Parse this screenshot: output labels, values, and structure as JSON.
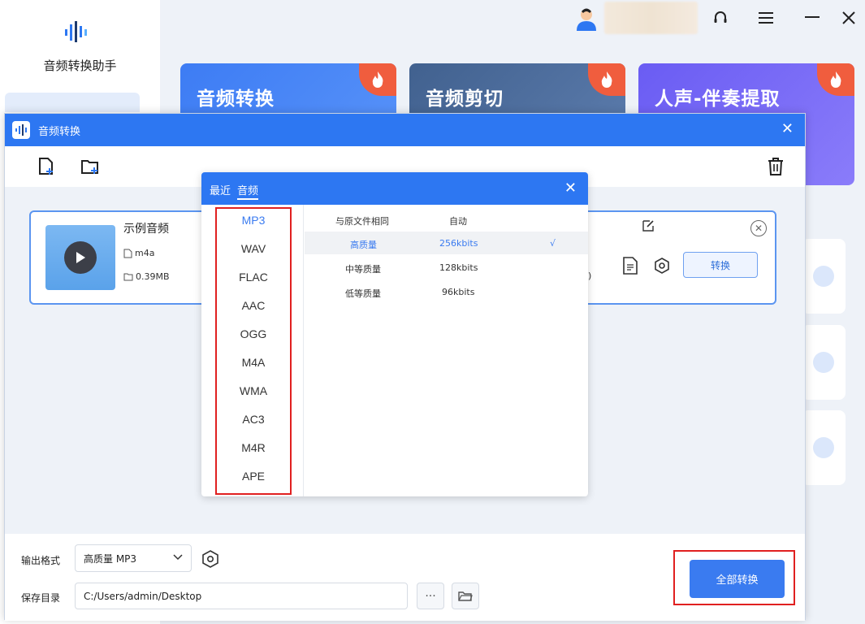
{
  "app": {
    "name": "音频转换助手"
  },
  "topbar": {
    "icons": [
      "user-avatar-icon",
      "headset-icon",
      "menu-icon",
      "minimize-icon",
      "close-icon"
    ]
  },
  "feature_cards": [
    {
      "title": "音频转换"
    },
    {
      "title": "音频剪切"
    },
    {
      "title": "人声-伴奏提取"
    }
  ],
  "modal": {
    "title": "音频转换",
    "file": {
      "name": "示例音频",
      "format": "m4a",
      "size": "0.39MB",
      "paren": ")",
      "convert_label": "转换"
    },
    "bottom": {
      "format_label": "输出格式",
      "format_value": "高质量 MP3",
      "dir_label": "保存目录",
      "dir_value": "C:/Users/admin/Desktop",
      "more_label": "···",
      "all_convert_label": "全部转换"
    }
  },
  "popup": {
    "tabs": [
      "最近",
      "音频"
    ],
    "formats": [
      "MP3",
      "WAV",
      "FLAC",
      "AAC",
      "OGG",
      "M4A",
      "WMA",
      "AC3",
      "M4R",
      "APE"
    ],
    "selected_format": "MP3",
    "quality_header": {
      "name": "与原文件相同",
      "rate": "自动"
    },
    "qualities": [
      {
        "name": "高质量",
        "rate": "256kbits",
        "check": "√"
      },
      {
        "name": "中等质量",
        "rate": "128kbits",
        "check": ""
      },
      {
        "name": "低等质量",
        "rate": "96kbits",
        "check": ""
      }
    ]
  },
  "colors": {
    "primary": "#2d77f2",
    "highlight_border": "#e02020",
    "selected_text": "#3a7bf0"
  }
}
